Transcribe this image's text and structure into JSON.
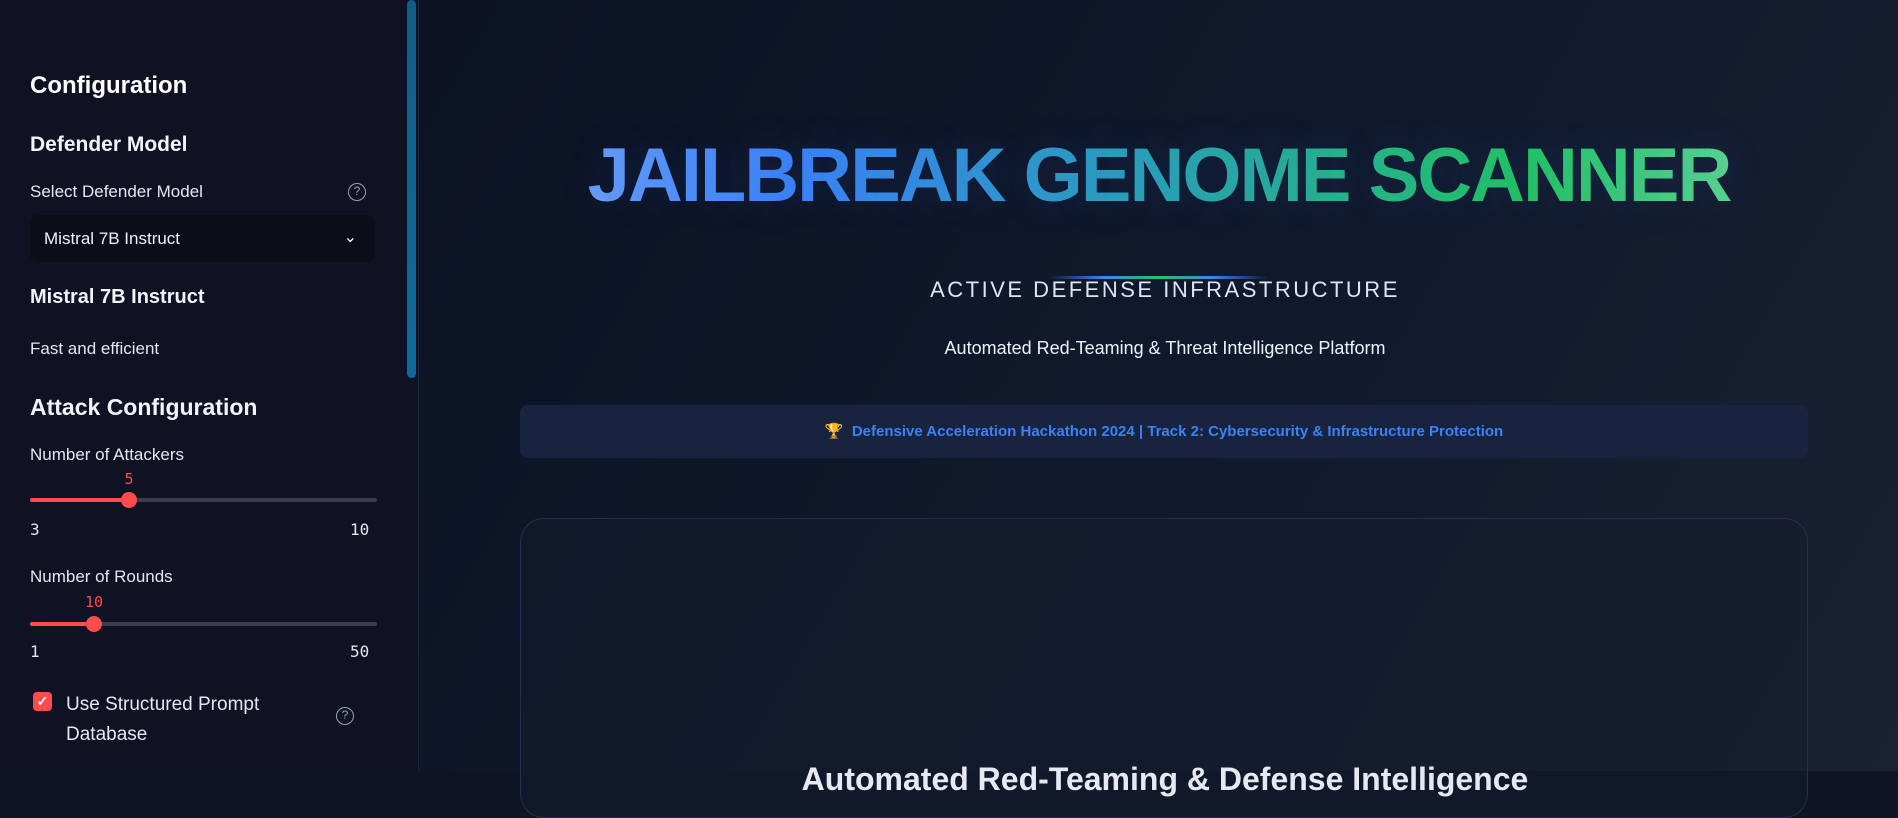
{
  "sidebar": {
    "title": "Configuration",
    "defender_heading": "Defender Model",
    "select_label": "Select Defender Model",
    "selected_model": "Mistral 7B Instruct",
    "model_name": "Mistral 7B Instruct",
    "model_desc": "Fast and efficient",
    "attack_heading": "Attack Configuration",
    "attackers": {
      "label": "Number of Attackers",
      "value": "5",
      "min": "3",
      "max": "10"
    },
    "rounds": {
      "label": "Number of Rounds",
      "value": "10",
      "min": "1",
      "max": "50"
    },
    "structured_db": {
      "label_line1": "Use Structured Prompt",
      "label_line2": "Database",
      "checked": true
    }
  },
  "main": {
    "title": "JAILBREAK GENOME SCANNER",
    "subtitle": "ACTIVE DEFENSE INFRASTRUCTURE",
    "tagline": "Automated Red-Teaming & Threat Intelligence Platform",
    "banner_icon": "🏆",
    "banner": "Defensive Acceleration Hackathon 2024 | Track 2: Cybersecurity & Infrastructure Protection",
    "card_heading": "Automated Red-Teaming & Defense Intelligence"
  },
  "colors": {
    "accent": "#ff4b4b",
    "brand_blue": "#3b82f6",
    "brand_green": "#22c55e"
  }
}
